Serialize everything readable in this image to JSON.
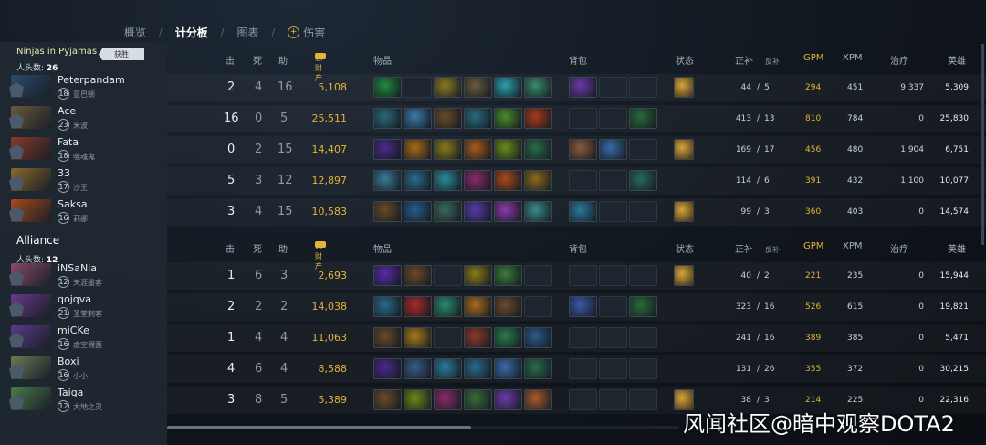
{
  "nav": {
    "tabs": [
      {
        "label": "概览",
        "active": false
      },
      {
        "label": "计分板",
        "active": true
      },
      {
        "label": "图表",
        "active": false
      },
      {
        "label": "伤害",
        "active": false
      }
    ],
    "separator": "/"
  },
  "teams": [
    {
      "name": "Ninjas in Pyjamas",
      "badge": "获胜",
      "kills_label": "人头数:",
      "kills": "26",
      "headers": {
        "kills": "击",
        "deaths": "死",
        "assists": "助",
        "net_worth": "总财产",
        "items": "物品",
        "backpack": "背包",
        "buffs": "状态",
        "lh": "正补",
        "dn": "反补",
        "gpm": "GPM",
        "xpm": "XPM",
        "heal": "治疗",
        "hero_damage": "英雄"
      },
      "players": [
        {
          "name": "Peterpandam",
          "level": "18",
          "hero": "亚巴顿",
          "color": "#2c4a6e",
          "k": "2",
          "d": "4",
          "a": "16",
          "nw": "5,108",
          "lh": "44",
          "dn": "5",
          "gpm": "294",
          "xpm": "451",
          "heal": "9,337",
          "hd": "5,309",
          "items": [
            "#1f8a3f",
            "",
            "#8a7a23",
            "#6a5a3a",
            "#2aa0a8",
            "#3a8a6a"
          ],
          "backpack": [
            "#6a3aa8",
            "",
            ""
          ],
          "buff": true
        },
        {
          "name": "Ace",
          "level": "23",
          "hero": "米波",
          "color": "#6a5a3a",
          "k": "16",
          "d": "0",
          "a": "5",
          "nw": "25,511",
          "lh": "413",
          "dn": "13",
          "gpm": "810",
          "xpm": "784",
          "heal": "0",
          "hd": "25,830",
          "items": [
            "#2a6a7a",
            "#3a7aa8",
            "#6a4a2a",
            "#2a6a7a",
            "#4a8a2a",
            "#a83a1a"
          ],
          "backpack": [
            "",
            "",
            "#2a6a3a"
          ],
          "buff": false
        },
        {
          "name": "Fata",
          "level": "18",
          "hero": "噬魂鬼",
          "color": "#8a3a2a",
          "k": "0",
          "d": "2",
          "a": "15",
          "nw": "14,407",
          "lh": "169",
          "dn": "17",
          "gpm": "456",
          "xpm": "480",
          "heal": "1,904",
          "hd": "6,751",
          "items": [
            "#4a2a8a",
            "#a86a1a",
            "#8a7a1a",
            "#a85a1a",
            "#6a8a1a",
            "#2a6a4a"
          ],
          "backpack": [
            "#8a5a3a",
            "#3a6aa8",
            ""
          ],
          "buff": true
        },
        {
          "name": "33",
          "level": "17",
          "hero": "沙王",
          "color": "#8a6a2a",
          "k": "5",
          "d": "3",
          "a": "12",
          "nw": "12,897",
          "lh": "114",
          "dn": "6",
          "gpm": "391",
          "xpm": "432",
          "heal": "1,100",
          "hd": "10,077",
          "items": [
            "#3a7a9a",
            "#2a6a8a",
            "#2a8a9a",
            "#8a2a6a",
            "#a84a1a",
            "#8a6a1a"
          ],
          "backpack": [
            "",
            "",
            "#2a6a5a"
          ],
          "buff": false
        },
        {
          "name": "Saksa",
          "level": "16",
          "hero": "莉娜",
          "color": "#a84a1a",
          "k": "3",
          "d": "4",
          "a": "15",
          "nw": "10,583",
          "lh": "99",
          "dn": "3",
          "gpm": "360",
          "xpm": "403",
          "heal": "0",
          "hd": "14,574",
          "items": [
            "#6a4a2a",
            "#2a5a8a",
            "#3a6a5a",
            "#5a3aa8",
            "#8a3aa8",
            "#3a8a8a"
          ],
          "backpack": [
            "#2a7a9a",
            "",
            ""
          ],
          "buff": true
        }
      ]
    },
    {
      "name": "Alliance",
      "badge": "",
      "kills_label": "人头数:",
      "kills": "12",
      "headers": {
        "kills": "击",
        "deaths": "死",
        "assists": "助",
        "net_worth": "总财产",
        "items": "物品",
        "backpack": "背包",
        "buffs": "状态",
        "lh": "正补",
        "dn": "反补",
        "gpm": "GPM",
        "xpm": "XPM",
        "heal": "治疗",
        "hero_damage": "英雄"
      },
      "players": [
        {
          "name": "iNSaNia",
          "level": "12",
          "hero": "天涯墨客",
          "color": "#8a4a6a",
          "k": "1",
          "d": "6",
          "a": "3",
          "nw": "2,693",
          "lh": "40",
          "dn": "2",
          "gpm": "221",
          "xpm": "235",
          "heal": "0",
          "hd": "15,944",
          "items": [
            "#5a2aa8",
            "#6a4a2a",
            "",
            "#8a7a1a",
            "#3a7a3a",
            ""
          ],
          "backpack": [
            "",
            "",
            ""
          ],
          "buff": true
        },
        {
          "name": "qojqva",
          "level": "21",
          "hero": "圣堂刺客",
          "color": "#6a3a8a",
          "k": "2",
          "d": "2",
          "a": "2",
          "nw": "14,038",
          "lh": "323",
          "dn": "16",
          "gpm": "526",
          "xpm": "615",
          "heal": "0",
          "hd": "19,821",
          "items": [
            "#2a6a8a",
            "#a82a2a",
            "#2a8a6a",
            "#a86a1a",
            "#6a4a2a",
            ""
          ],
          "backpack": [
            "#3a5aa8",
            "",
            "#2a6a3a"
          ],
          "buff": false
        },
        {
          "name": "miCKe",
          "level": "16",
          "hero": "虚空假面",
          "color": "#5a3a8a",
          "k": "1",
          "d": "4",
          "a": "4",
          "nw": "11,063",
          "lh": "241",
          "dn": "16",
          "gpm": "389",
          "xpm": "385",
          "heal": "0",
          "hd": "5,471",
          "items": [
            "#6a4a2a",
            "#a87a1a",
            "",
            "#8a3a2a",
            "#2a7a4a",
            "#2a5a8a"
          ],
          "backpack": [
            "",
            "",
            ""
          ],
          "buff": false
        },
        {
          "name": "Boxi",
          "level": "16",
          "hero": "小小",
          "color": "#6a7a5a",
          "k": "4",
          "d": "6",
          "a": "4",
          "nw": "8,588",
          "lh": "131",
          "dn": "26",
          "gpm": "355",
          "xpm": "372",
          "heal": "0",
          "hd": "30,215",
          "items": [
            "#4a2a8a",
            "#3a5a8a",
            "#2a7a9a",
            "#2a6a8a",
            "#3a6aa8",
            "#2a6a4a"
          ],
          "backpack": [
            "",
            "",
            ""
          ],
          "buff": false
        },
        {
          "name": "Taiga",
          "level": "12",
          "hero": "大地之灵",
          "color": "#4a7a4a",
          "k": "3",
          "d": "8",
          "a": "5",
          "nw": "5,389",
          "lh": "38",
          "dn": "3",
          "gpm": "214",
          "xpm": "225",
          "heal": "0",
          "hd": "22,316",
          "items": [
            "#6a4a2a",
            "#6a8a1a",
            "#8a2a6a",
            "#3a6a3a",
            "#6a3aa8",
            "#a85a2a"
          ],
          "backpack": [
            "",
            "",
            ""
          ],
          "buff": true
        }
      ]
    }
  ],
  "watermark": "风闻社区@暗中观察DOTA2"
}
